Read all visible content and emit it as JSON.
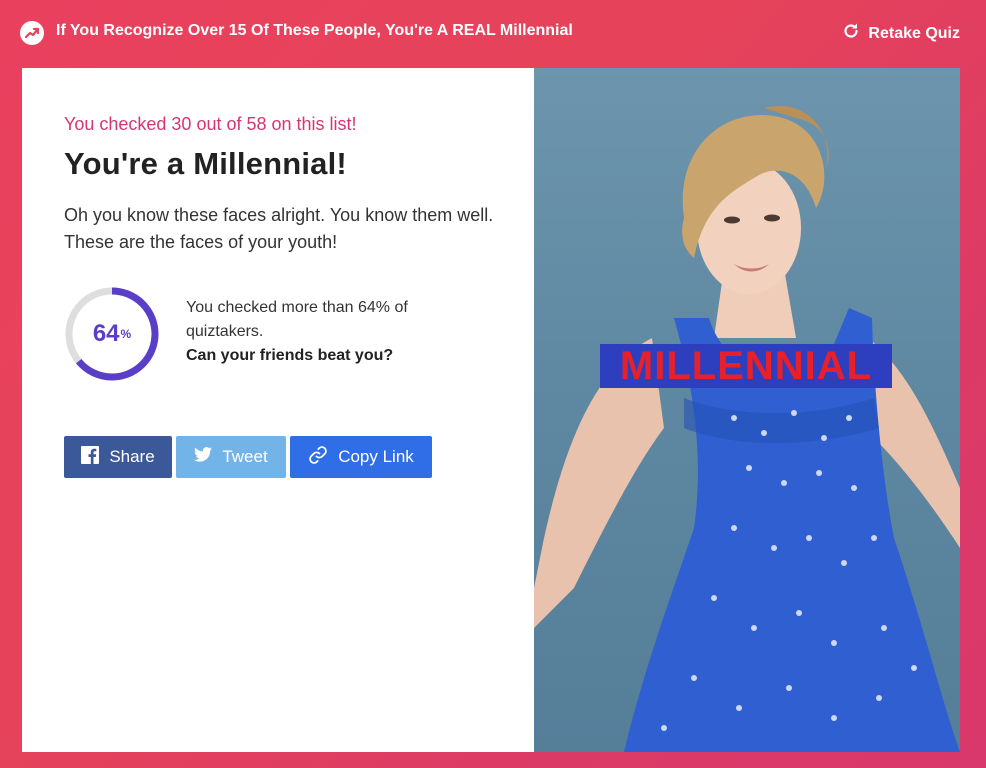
{
  "header": {
    "quiz_title": "If You Recognize Over 15 Of These People, You're A REAL Millennial",
    "retake_label": "Retake Quiz",
    "trend_icon": "trending-icon",
    "retake_icon": "refresh-icon"
  },
  "result": {
    "checked_count_text": "You checked 30 out of 58 on this list!",
    "title": "You're a Millennial!",
    "description": "Oh you know these faces alright. You know them well. These are the faces of your youth!"
  },
  "stats": {
    "percent_value": "64",
    "percent_sign": "%",
    "percent_fraction": 0.64,
    "comparison_text": "You checked more than 64% of quiztakers.",
    "challenge_text": "Can your friends beat you?"
  },
  "share": {
    "facebook_label": "Share",
    "twitter_label": "Tweet",
    "copy_label": "Copy Link"
  },
  "image": {
    "banner_text": "MILLENNIAL"
  },
  "colors": {
    "accent_pink": "#d63574",
    "ring_purple": "#5a3ec8",
    "facebook": "#3b5998",
    "twitter": "#73b4e8",
    "copy_link": "#2f6ee6"
  }
}
